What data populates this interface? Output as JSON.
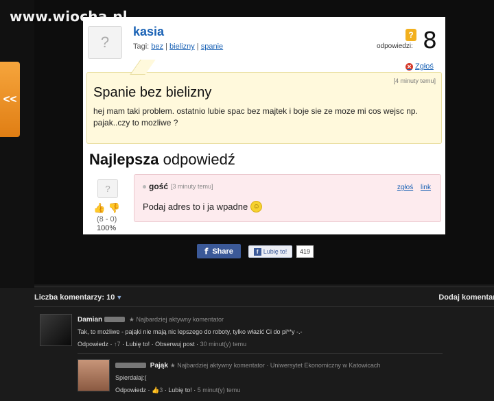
{
  "site": {
    "logo": "www.wiocha.pl",
    "back_label": "<<"
  },
  "question": {
    "user": "kasia",
    "avatar_label": "?",
    "tags_label": "Tagi:",
    "tags": [
      "bez",
      "bielizny",
      "spanie"
    ],
    "answers_label": "odpowiedzi:",
    "answers_badge": "?",
    "answers_count": "8",
    "report": "Zgłoś",
    "time": "[4 minuty temu]",
    "title": "Spanie bez bielizny",
    "body": "hej mam taki problem. ostatnio lubie spac bez majtek i boje sie ze moze mi cos wejsc np. pajak..czy to mozliwe ?"
  },
  "best_answer": {
    "heading_bold": "Najlepsza",
    "heading_rest": "odpowiedź",
    "author": "gość",
    "time": "[3 minuty temu]",
    "report": "zgłoś",
    "link": "link",
    "text": "Podaj adres to i ja wpadne",
    "score": "(8 - 0)",
    "percent": "100%"
  },
  "social": {
    "share_label": "Share",
    "like_label": "Lubię to!",
    "like_count": "419"
  },
  "comments": {
    "count_label": "Liczba komentarzy: 10",
    "add_label": "Dodaj komentarz",
    "items": [
      {
        "name": "Damian",
        "meta": "★ Najbardziej aktywny komentator",
        "text": "Tak, to możliwe - pająki nie mają nic lepszego do roboty, tylko włazić Ci do pi**y -.-",
        "reply": "Odpowiedz",
        "votes": "↑7",
        "like": "Lubię to!",
        "follow": "Obserwuj post",
        "time": "30 minut(y) temu"
      },
      {
        "name": "Pająk",
        "meta": "★ Najbardziej aktywny komentator · Uniwersytet Ekonomiczny w Katowicach",
        "text": "Spierdalaj:(",
        "reply": "Odpowiedz",
        "votes": "3",
        "like": "Lubię to!",
        "time": "5 minut(y) temu"
      }
    ]
  }
}
